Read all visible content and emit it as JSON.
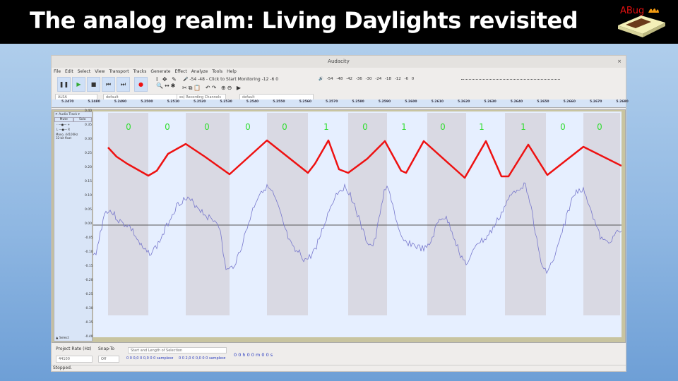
{
  "slide": {
    "title": "The analog realm: Living Daylights revisited",
    "logo_text": "ABug"
  },
  "window": {
    "title": "Audacity",
    "close": "×"
  },
  "menu": [
    "File",
    "Edit",
    "Select",
    "View",
    "Transport",
    "Tracks",
    "Generate",
    "Effect",
    "Analyze",
    "Tools",
    "Help"
  ],
  "transport": {
    "pause": "❚❚",
    "play": "▶",
    "stop": "■",
    "skip_start": "⏮",
    "skip_end": "⏭",
    "record": "●"
  },
  "meters": {
    "record_hint": "Click to Start Monitoring",
    "record_scale": [
      "-54",
      "-48",
      "-12",
      "-6",
      "0"
    ],
    "play_scale": [
      "-54",
      "-48",
      "-42",
      "-36",
      "-30",
      "-24",
      "-18",
      "-12",
      "-6",
      "0"
    ]
  },
  "devices": {
    "host": "ALSA",
    "recording_device": "default",
    "channels": "es) Recording Channels",
    "playback_device": "default"
  },
  "ruler": [
    "5.2470",
    "5.2480",
    "5.2490",
    "5.2500",
    "5.2510",
    "5.2520",
    "5.2530",
    "5.2540",
    "5.2550",
    "5.2560",
    "5.2570",
    "5.2580",
    "5.2590",
    "5.2600",
    "5.2610",
    "5.2620",
    "5.2630",
    "5.2640",
    "5.2650",
    "5.2660",
    "5.2670",
    "5.2680"
  ],
  "track": {
    "name": "Audio Track",
    "mute": "Mute",
    "solo": "Solo",
    "gain_minus": "-",
    "gain_plus": "+",
    "pan_l": "L",
    "pan_r": "R",
    "info": "Mono, 44100Hz\n32-bit float",
    "select": "Select"
  },
  "yaxis": [
    "0.40",
    "0.35",
    "0.30",
    "0.25",
    "0.20",
    "0.15",
    "0.10",
    "0.05",
    "0.00",
    "-0.05",
    "-0.10",
    "-0.15",
    "-0.20",
    "-0.25",
    "-0.30",
    "-0.35",
    "-0.40"
  ],
  "bits": [
    "0",
    "0",
    "0",
    "0",
    "0",
    "1",
    "0",
    "1",
    "0",
    "1",
    "1",
    "0",
    "0"
  ],
  "colors": {
    "bits": "#33dd33",
    "overlay": "#ee1111",
    "waveform": "#7777cc",
    "band": "#d9d9e3"
  },
  "bottom": {
    "rate_label": "Project Rate (Hz)",
    "rate": "44100",
    "snap_label": "Snap-To",
    "snap": "Off",
    "selection_label": "Start and Length of Selection",
    "start": "0 0 0,0 0 0,0 0 0",
    "start_unit": "samples",
    "length": "0 0 2,0 0 0,0 0 0",
    "length_unit": "samples",
    "time": "0 0 h 0 0 m 0 0 s"
  },
  "status": "Stopped."
}
